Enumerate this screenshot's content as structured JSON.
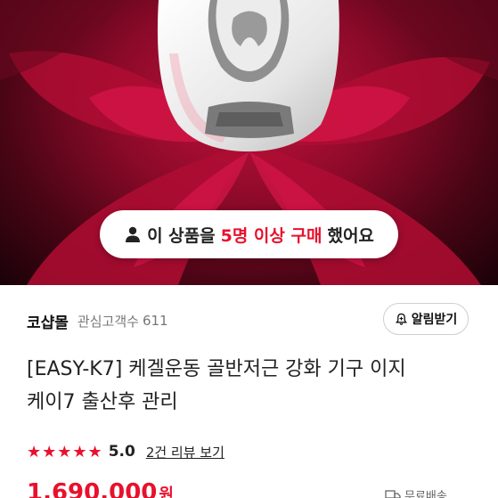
{
  "hero": {
    "purchase_badge": {
      "prefix": "이 상품을",
      "highlight": "5명 이상 구매",
      "suffix": "했어요",
      "icon": "person-icon"
    }
  },
  "seller": {
    "name": "코샵몰",
    "fans_label": "관심고객수",
    "fans_count": "611",
    "notify_label": "알림받기",
    "notify_icon": "bell-plus-icon"
  },
  "product": {
    "title_line1": "[EASY-K7] 케겔운동 골반저근 강화 기구 이지",
    "title_line2": "케이7 출산후 관리",
    "stars": "★★★★★",
    "rating": 5.0,
    "rating_text": "5.0",
    "reviews_link": "2건 리뷰 보기",
    "price": "1,690,000",
    "currency": "원",
    "shipping": "무료배송"
  },
  "colors": {
    "accent": "#e8112d",
    "hero_bg": "#8e0a2a"
  }
}
